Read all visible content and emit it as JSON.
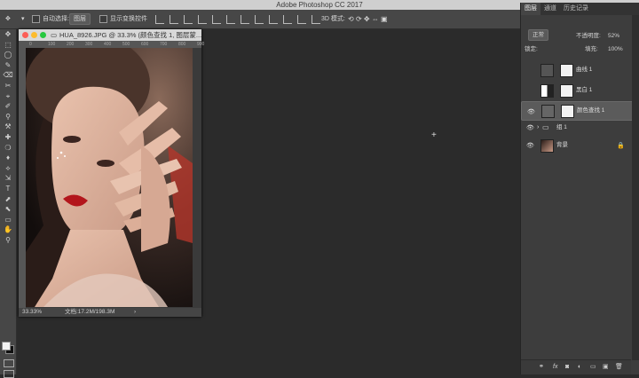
{
  "app": {
    "title": "Adobe Photoshop CC 2017"
  },
  "options": {
    "auto_select": "自动选择:",
    "layer_select": "图层",
    "show_transform": "显示变换控件",
    "mode3d": "3D 模式:"
  },
  "tools": [
    "✥",
    "⬚",
    "◯",
    "✎",
    "⌫",
    "✂",
    "⌖",
    "✐",
    "⚲",
    "⚒",
    "✚",
    "❍",
    "♦",
    "⟡",
    "⇲",
    "T",
    "⬈",
    "⬉",
    "▭",
    "✋",
    "⚲"
  ],
  "document": {
    "title": "HUA_8926.JPG @ 33.3% (颜色查找 1, 图层蒙...",
    "zoom": "33.33%",
    "file_info": "文档:17.2M/198.3M",
    "ruler_ticks": [
      "0",
      "100",
      "200",
      "300",
      "400",
      "500",
      "600",
      "700",
      "800",
      "900"
    ]
  },
  "panel": {
    "tabs": [
      "图层",
      "通道",
      "历史记录"
    ],
    "kind_label": "正常",
    "opacity_label": "不透明度:",
    "opacity_value": "52%",
    "lock_label": "锁定:",
    "fill_label": "填充:",
    "fill_value": "100%",
    "layers": [
      {
        "name": "曲线 1",
        "visible": false,
        "selected": false
      },
      {
        "name": "黑白 1",
        "visible": false,
        "selected": false
      },
      {
        "name": "颜色查找 1",
        "visible": true,
        "selected": true
      },
      {
        "name": "组 1",
        "visible": true,
        "selected": false
      },
      {
        "name": "背景",
        "visible": true,
        "selected": false
      }
    ],
    "footer_icons": [
      "link-icon",
      "fx-icon",
      "mask-icon",
      "adjustment-icon",
      "folder-icon",
      "new-layer-icon",
      "trash-icon"
    ]
  },
  "colors": {
    "accent": "#5b5b5b",
    "foreground": "#f4f4f4",
    "background": "#111111"
  }
}
